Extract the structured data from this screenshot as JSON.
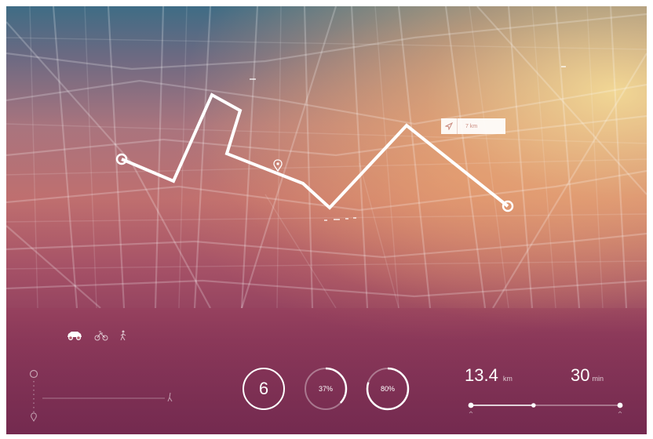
{
  "map": {
    "route_distance_tag": "7 km"
  },
  "panel": {
    "modes": [
      "car-icon",
      "bike-icon",
      "walk-icon"
    ],
    "stat_circles": [
      {
        "label": "6",
        "progress": 1.0
      },
      {
        "label": "37%",
        "progress": 0.37
      },
      {
        "label": "80%",
        "progress": 0.8
      }
    ],
    "distance": {
      "value": "13.4",
      "unit": "km"
    },
    "duration": {
      "value": "30",
      "unit": "min"
    },
    "slider_progress": 0.42
  },
  "colors": {
    "accent": "#ffffff",
    "track": "rgba(255,255,255,0.35)"
  }
}
